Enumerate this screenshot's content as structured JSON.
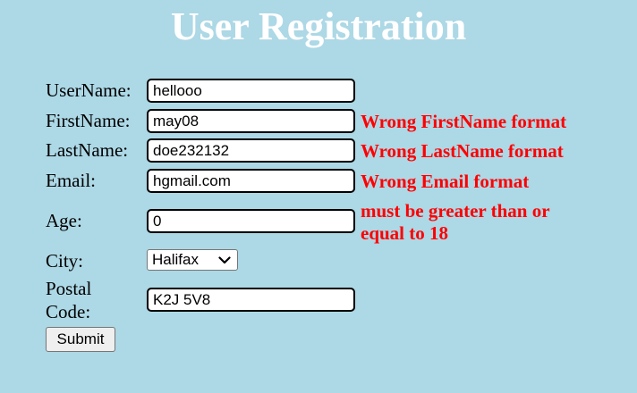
{
  "title": "User Registration",
  "form": {
    "username": {
      "label": "UserName:",
      "value": "hellooo"
    },
    "firstname": {
      "label": "FirstName:",
      "value": "may08",
      "error": "Wrong FirstName format"
    },
    "lastname": {
      "label": "LastName:",
      "value": "doe232132",
      "error": "Wrong LastName format"
    },
    "email": {
      "label": "Email:",
      "value": "hgmail.com",
      "error": "Wrong Email format"
    },
    "age": {
      "label": "Age:",
      "value": "0",
      "error_line1": "must be greater than or",
      "error_line2": "equal to 18"
    },
    "city": {
      "label": "City:",
      "selected": "Halifax"
    },
    "postal": {
      "label_line1": "Postal",
      "label_line2": "Code:",
      "value": "K2J 5V8"
    },
    "submit_label": "Submit"
  },
  "colors": {
    "background": "#add8e6",
    "title": "#ffffff",
    "error": "#ff0000"
  },
  "icons": {
    "city_dropdown": "chevron-down-icon"
  }
}
